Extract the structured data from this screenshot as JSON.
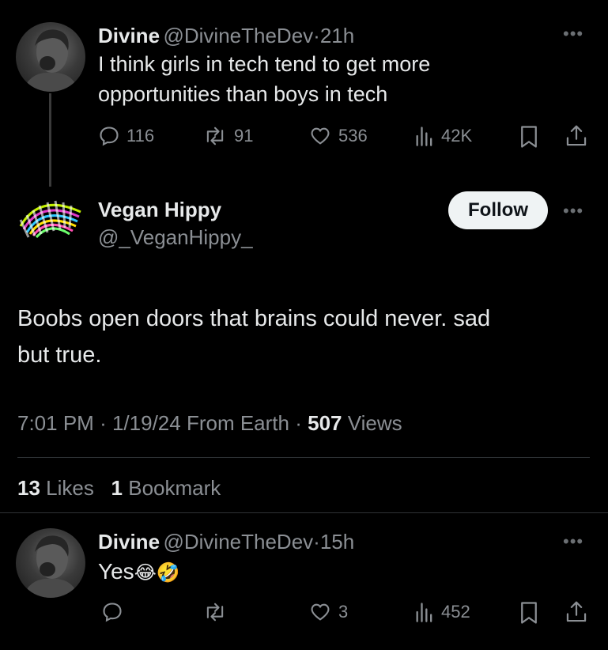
{
  "parent_tweet": {
    "name": "Divine",
    "handle": "@DivineTheDev",
    "sep": "·",
    "time": "21h",
    "text_line1": "I think girls in tech tend to get more",
    "text_line2": "opportunities than boys in tech",
    "replies": "116",
    "retweets": "91",
    "likes": "536",
    "views": "42K"
  },
  "main_tweet": {
    "name": "Vegan Hippy",
    "handle": "@_VeganHippy_",
    "follow_label": "Follow",
    "text_line1": "Boobs open doors that brains could never. sad",
    "text_line2": "but true.",
    "time": "7:01 PM",
    "date": "1/19/24",
    "source": "From Earth",
    "views_count": "507",
    "views_label": "Views",
    "likes_count": "13",
    "likes_label": "Likes",
    "bookmarks_count": "1",
    "bookmarks_label": "Bookmark"
  },
  "reply_tweet": {
    "name": "Divine",
    "handle": "@DivineTheDev",
    "sep": "·",
    "time": "15h",
    "text": "Yes",
    "emoji": "😂🤣",
    "likes": "3",
    "views": "452"
  },
  "icons": [
    "reply-icon",
    "retweet-icon",
    "like-icon",
    "views-icon",
    "bookmark-icon",
    "share-icon",
    "more-icon"
  ],
  "colors": {
    "background": "#000000",
    "text": "#e7e9ea",
    "muted": "#8b8f94",
    "follow_bg": "#eff3f4"
  }
}
